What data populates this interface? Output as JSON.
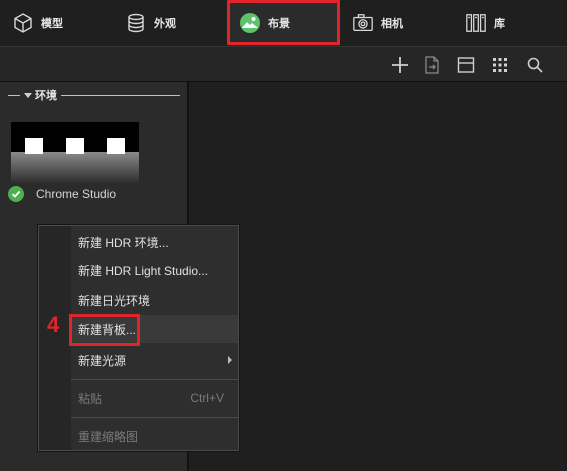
{
  "tabs": [
    {
      "label": "模型",
      "icon": "cube-icon"
    },
    {
      "label": "外观",
      "icon": "material-stack-icon"
    },
    {
      "label": "布景",
      "icon": "environment-landscape-icon",
      "active": true
    },
    {
      "label": "相机",
      "icon": "camera-icon"
    },
    {
      "label": "库",
      "icon": "library-books-icon"
    }
  ],
  "toolbar": {
    "icons": [
      "add-icon",
      "import-file-icon",
      "panel-layout-icon",
      "grid-view-icon",
      "search-icon"
    ]
  },
  "environment_section": {
    "title": "环境",
    "items": [
      {
        "name": "Chrome Studio",
        "active": true
      }
    ]
  },
  "context_menu": {
    "items": [
      {
        "label": "新建 HDR 环境...",
        "enabled": true
      },
      {
        "label": "新建 HDR Light Studio...",
        "enabled": true
      },
      {
        "label": "新建日光环境",
        "enabled": true
      },
      {
        "label": "新建背板...",
        "enabled": true,
        "highlighted": true
      },
      {
        "label": "新建光源",
        "enabled": true,
        "submenu": true
      },
      {
        "label": "粘贴",
        "enabled": false,
        "shortcut": "Ctrl+V"
      },
      {
        "label": "重建缩略图",
        "enabled": false
      }
    ]
  },
  "annotation": {
    "step_number": "4"
  },
  "colors": {
    "highlight": "#e0242a",
    "check": "#4caf50",
    "background": "#1e1e1e",
    "panel": "#2b2b2b"
  }
}
